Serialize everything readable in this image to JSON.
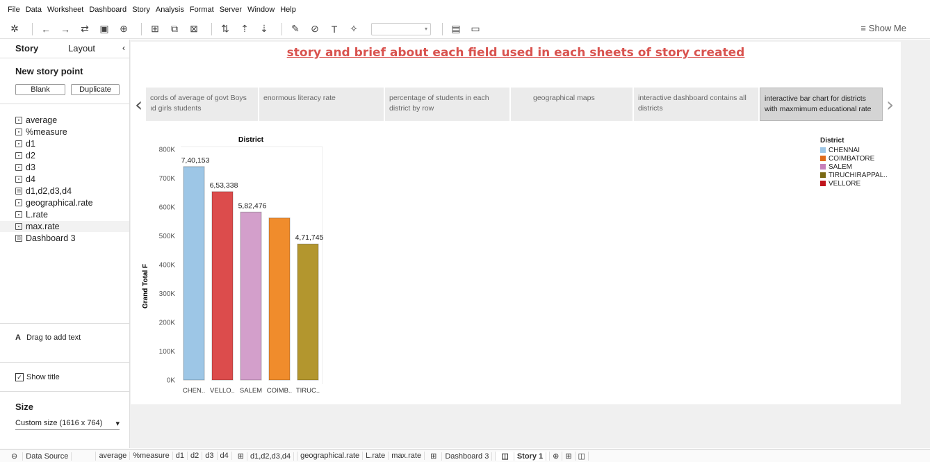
{
  "menu": [
    "File",
    "Data",
    "Worksheet",
    "Dashboard",
    "Story",
    "Analysis",
    "Format",
    "Server",
    "Window",
    "Help"
  ],
  "toolbar": {
    "show_me": "Show Me"
  },
  "left_panel": {
    "tab_story": "Story",
    "tab_layout": "Layout",
    "collapse": "‹",
    "new_story_point": "New story point",
    "blank_label": "Blank",
    "duplicate_label": "Duplicate",
    "sheets": [
      "average",
      "%measure",
      "d1",
      "d2",
      "d3",
      "d4",
      "d1,d2,d3,d4",
      "geographical.rate",
      "L.rate",
      "max.rate",
      "Dashboard 3"
    ],
    "drag_text": "Drag to add text",
    "drag_icon": "A",
    "show_title": "Show title",
    "size_title": "Size",
    "size_value": "Custom size (1616 x 764)"
  },
  "story": {
    "title": "story and brief about each field used in each  sheets of story created",
    "points": [
      "cords of average of govt Boys\nıd girls students",
      "enormous literacy rate",
      "percentage of students in each\ndistrict by row",
      "geographical maps",
      "interactive dashboard contains all\ndistricts",
      "interactive bar chart for districts\nwith maxmimum educational rate"
    ]
  },
  "chart_data": {
    "type": "bar",
    "title": "District",
    "ylabel": "Grand Total F",
    "categories": [
      "CHEN..",
      "VELLO..",
      "SALEM",
      "COIMB..",
      "TIRUC.."
    ],
    "values": [
      740153,
      653338,
      582476,
      562000,
      471745
    ],
    "value_labels": [
      "7,40,153",
      "6,53,338",
      "5,82,476",
      "",
      "4,71,745"
    ],
    "colors": [
      "#9dc6e6",
      "#dc4c4c",
      "#d39fcb",
      "#f08c2c",
      "#b3962e"
    ],
    "ylim": [
      0,
      800000
    ],
    "yticks": [
      "0K",
      "100K",
      "200K",
      "300K",
      "400K",
      "500K",
      "600K",
      "700K",
      "800K"
    ],
    "legend_title": "District",
    "legend": [
      {
        "name": "CHENNAI",
        "color": "#9dc6e6"
      },
      {
        "name": "COIMBATORE",
        "color": "#e06a1a"
      },
      {
        "name": "SALEM",
        "color": "#c77fba"
      },
      {
        "name": "TIRUCHIRAPPAL..",
        "color": "#7a6a14"
      },
      {
        "name": "VELLORE",
        "color": "#c0141c"
      }
    ]
  },
  "bottom_tabs": [
    "Data Source",
    "average",
    "%measure",
    "d1",
    "d2",
    "d3",
    "d4",
    "d1,d2,d3,d4",
    "geographical.rate",
    "L.rate",
    "max.rate",
    "Dashboard 3",
    "Story 1"
  ]
}
